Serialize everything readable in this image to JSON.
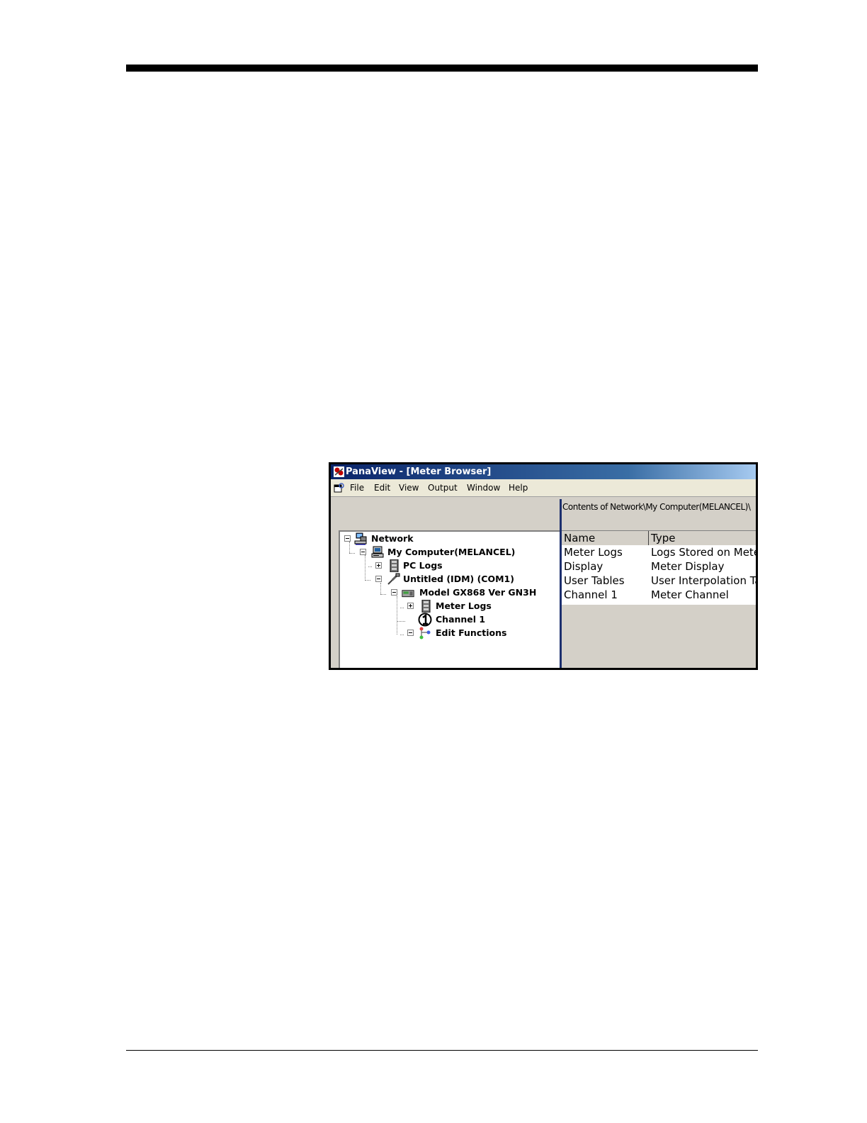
{
  "window": {
    "title": "PanaView - [Meter Browser]"
  },
  "menu": [
    "File",
    "Edit",
    "View",
    "Output",
    "Window",
    "Help"
  ],
  "tree": [
    {
      "label": "Network",
      "icon": "network-icon"
    },
    {
      "label": "My Computer(MELANCEL)",
      "icon": "computer-icon"
    },
    {
      "label": "PC Logs",
      "icon": "logs-icon"
    },
    {
      "label": "Untitled (IDM) (COM1)",
      "icon": "cable-icon"
    },
    {
      "label": "Model GX868 Ver GN3H",
      "icon": "meter-icon"
    },
    {
      "label": "Meter Logs",
      "icon": "logs-icon"
    },
    {
      "label": "Channel 1",
      "icon": "channel-1-icon"
    },
    {
      "label": "Edit Functions",
      "icon": "functions-icon"
    }
  ],
  "contents": {
    "path": "Contents of Network\\My Computer(MELANCEL)\\",
    "columns": [
      "Name",
      "Type"
    ],
    "rows": [
      {
        "name": "Meter Logs",
        "type": "Logs Stored on Meter"
      },
      {
        "name": "Display",
        "type": "Meter Display"
      },
      {
        "name": "User Tables",
        "type": "User Interpolation Tables"
      },
      {
        "name": "Channel 1",
        "type": "Meter Channel"
      }
    ]
  }
}
